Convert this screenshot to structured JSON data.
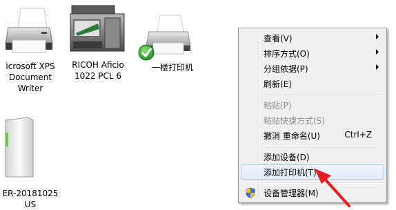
{
  "devices": [
    {
      "id": "xps",
      "label": "icrosoft XPS\nDocument\nWriter",
      "icon": "printer-icon"
    },
    {
      "id": "ricoh",
      "label": "RICOH Aficio\n1022 PCL 6",
      "icon": "multifunction-printer-icon"
    },
    {
      "id": "floor1",
      "label": "一楼打印机",
      "icon": "printer-default-icon"
    },
    {
      "id": "pc",
      "label": "ER-20181025\nUS",
      "icon": "computer-tower-icon"
    }
  ],
  "context_menu": {
    "items": [
      {
        "label": "查看(V)",
        "submenu": true,
        "enabled": true
      },
      {
        "label": "排序方式(O)",
        "submenu": true,
        "enabled": true
      },
      {
        "label": "分组依据(P)",
        "submenu": true,
        "enabled": true
      },
      {
        "label": "刷新(E)",
        "enabled": true
      },
      {
        "label": "粘贴(P)",
        "enabled": false
      },
      {
        "label": "粘贴快捷方式(S)",
        "enabled": false
      },
      {
        "label": "撤消 重命名(U)",
        "shortcut": "Ctrl+Z",
        "enabled": true
      },
      {
        "label": "添加设备(D)",
        "enabled": true
      },
      {
        "label": "添加打印机(T)",
        "enabled": true,
        "highlighted": true
      },
      {
        "label": "设备管理器(M)",
        "enabled": true,
        "icon": "uac-shield-icon"
      }
    ]
  },
  "annotation": {
    "type": "red-arrow-pointer",
    "color": "#e02020"
  }
}
